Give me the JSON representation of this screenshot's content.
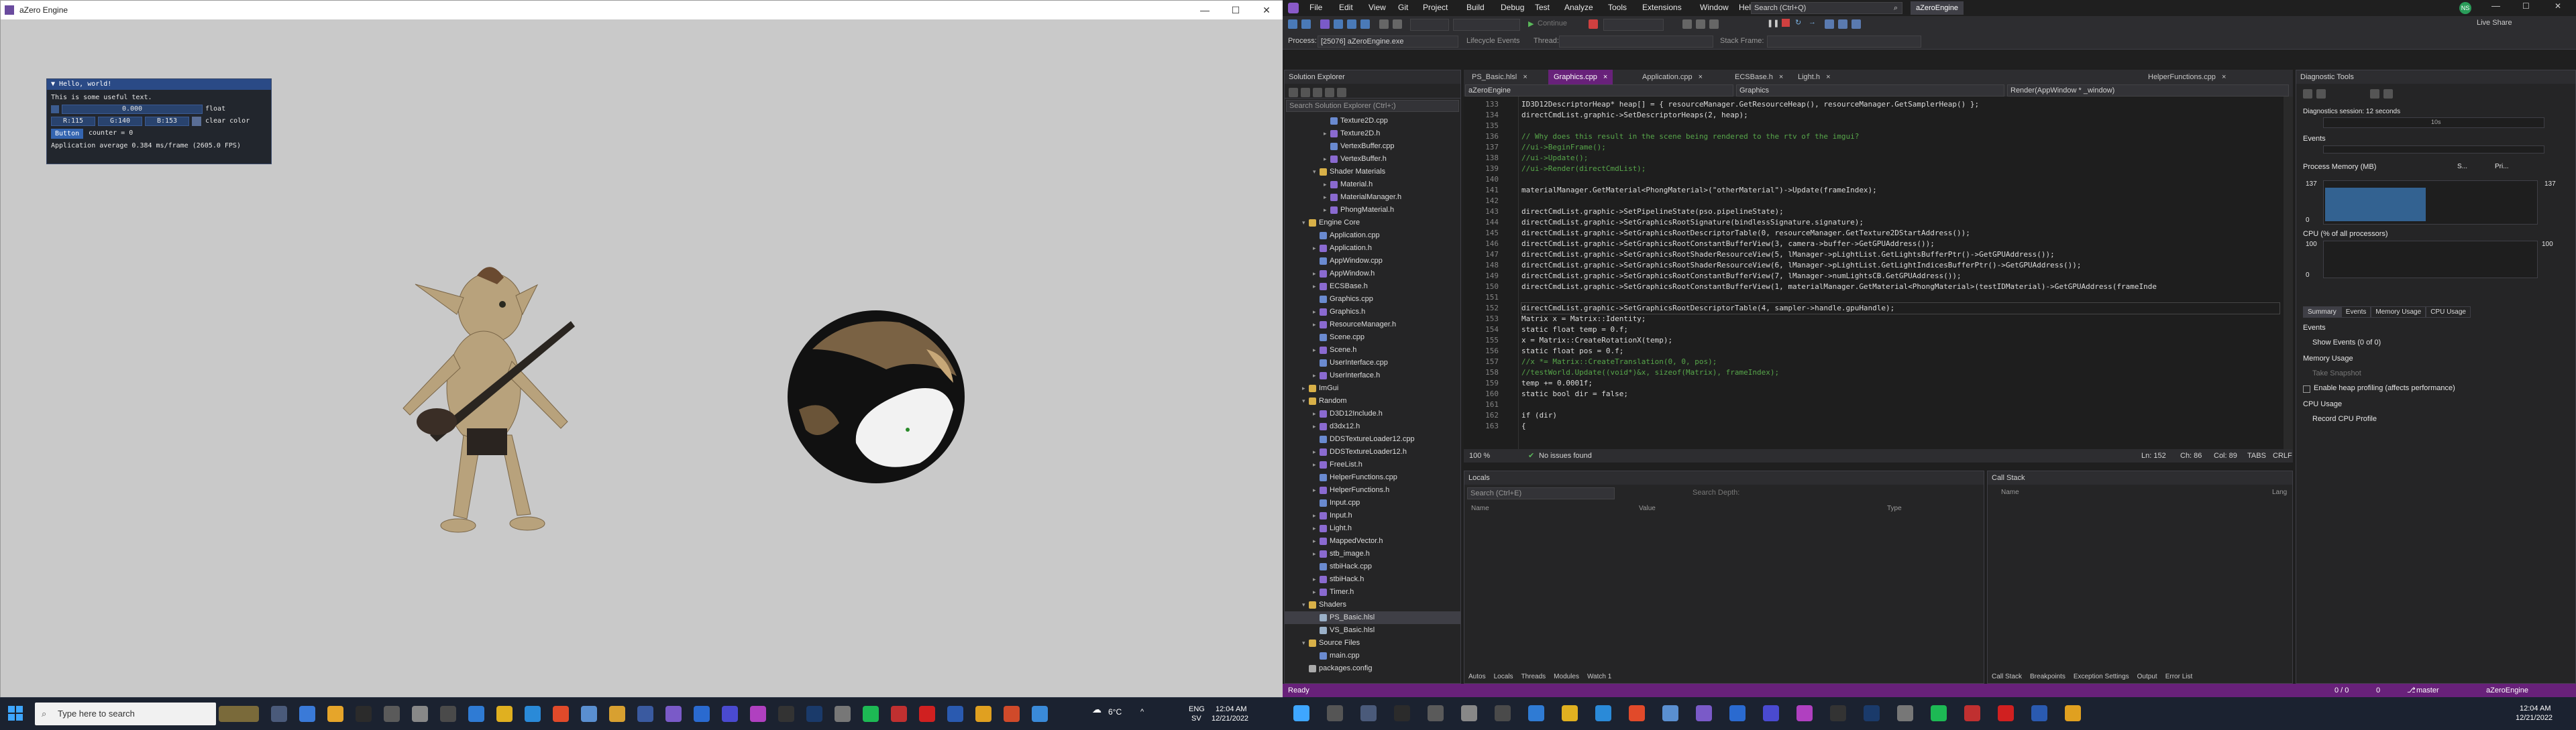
{
  "game": {
    "title": "aZero Engine",
    "imgui": {
      "window_title": "Hello, world!",
      "text": "This is some useful text.",
      "float_value": "0.000",
      "float_label": "float",
      "clear_r": "R:115",
      "clear_g": "G:140",
      "clear_b": "B:153",
      "clear_label": "clear color",
      "button": "Button",
      "counter": "counter = 0",
      "fps": "Application average 0.384 ms/frame (2605.0 FPS)"
    }
  },
  "taskbar": {
    "search_placeholder": "Type here to search",
    "weather": "6°C",
    "lang1": "ENG",
    "lang2": "SV",
    "time": "12:04 AM",
    "date": "12/21/2022"
  },
  "vs": {
    "menu": [
      "File",
      "Edit",
      "View",
      "Git",
      "Project",
      "Build",
      "Debug",
      "Test",
      "Analyze",
      "Tools",
      "Extensions",
      "Window",
      "Help"
    ],
    "search": "Search (Ctrl+Q)",
    "solution_name": "aZeroEngine",
    "avatar": "NS",
    "live_share": "Live Share",
    "continue": "Continue",
    "process_label": "Process:",
    "process_value": "[25076] aZeroEngine.exe",
    "lifecycle": "Lifecycle Events",
    "thread": "Thread:",
    "stack_frame": "Stack Frame:",
    "solution_explorer": {
      "title": "Solution Explorer",
      "search": "Search Solution Explorer (Ctrl+;)",
      "items": [
        {
          "label": "Texture2D.cpp",
          "depth": 3,
          "icon": "cpp",
          "exp": ""
        },
        {
          "label": "Texture2D.h",
          "depth": 3,
          "icon": "h",
          "exp": "▸"
        },
        {
          "label": "VertexBuffer.cpp",
          "depth": 3,
          "icon": "cpp",
          "exp": ""
        },
        {
          "label": "VertexBuffer.h",
          "depth": 3,
          "icon": "h",
          "exp": "▸"
        },
        {
          "label": "Shader Materials",
          "depth": 2,
          "icon": "folder",
          "exp": "▾"
        },
        {
          "label": "Material.h",
          "depth": 3,
          "icon": "h",
          "exp": "▸"
        },
        {
          "label": "MaterialManager.h",
          "depth": 3,
          "icon": "h",
          "exp": "▸"
        },
        {
          "label": "PhongMaterial.h",
          "depth": 3,
          "icon": "h",
          "exp": "▸"
        },
        {
          "label": "Engine Core",
          "depth": 1,
          "icon": "folder",
          "exp": "▾"
        },
        {
          "label": "Application.cpp",
          "depth": 2,
          "icon": "cpp",
          "exp": ""
        },
        {
          "label": "Application.h",
          "depth": 2,
          "icon": "h",
          "exp": "▸"
        },
        {
          "label": "AppWindow.cpp",
          "depth": 2,
          "icon": "cpp",
          "exp": ""
        },
        {
          "label": "AppWindow.h",
          "depth": 2,
          "icon": "h",
          "exp": "▸"
        },
        {
          "label": "ECSBase.h",
          "depth": 2,
          "icon": "h",
          "exp": "▸"
        },
        {
          "label": "Graphics.cpp",
          "depth": 2,
          "icon": "cpp",
          "exp": ""
        },
        {
          "label": "Graphics.h",
          "depth": 2,
          "icon": "h",
          "exp": "▸"
        },
        {
          "label": "ResourceManager.h",
          "depth": 2,
          "icon": "h",
          "exp": "▸"
        },
        {
          "label": "Scene.cpp",
          "depth": 2,
          "icon": "cpp",
          "exp": ""
        },
        {
          "label": "Scene.h",
          "depth": 2,
          "icon": "h",
          "exp": "▸"
        },
        {
          "label": "UserInterface.cpp",
          "depth": 2,
          "icon": "cpp",
          "exp": ""
        },
        {
          "label": "UserInterface.h",
          "depth": 2,
          "icon": "h",
          "exp": "▸"
        },
        {
          "label": "ImGui",
          "depth": 1,
          "icon": "folder",
          "exp": "▸"
        },
        {
          "label": "Random",
          "depth": 1,
          "icon": "folder",
          "exp": "▾"
        },
        {
          "label": "D3D12Include.h",
          "depth": 2,
          "icon": "h",
          "exp": "▸"
        },
        {
          "label": "d3dx12.h",
          "depth": 2,
          "icon": "h",
          "exp": "▸"
        },
        {
          "label": "DDSTextureLoader12.cpp",
          "depth": 2,
          "icon": "cpp",
          "exp": ""
        },
        {
          "label": "DDSTextureLoader12.h",
          "depth": 2,
          "icon": "h",
          "exp": "▸"
        },
        {
          "label": "FreeList.h",
          "depth": 2,
          "icon": "h",
          "exp": "▸"
        },
        {
          "label": "HelperFunctions.cpp",
          "depth": 2,
          "icon": "cpp",
          "exp": ""
        },
        {
          "label": "HelperFunctions.h",
          "depth": 2,
          "icon": "h",
          "exp": "▸"
        },
        {
          "label": "Input.cpp",
          "depth": 2,
          "icon": "cpp",
          "exp": ""
        },
        {
          "label": "Input.h",
          "depth": 2,
          "icon": "h",
          "exp": "▸"
        },
        {
          "label": "Light.h",
          "depth": 2,
          "icon": "h",
          "exp": "▸"
        },
        {
          "label": "MappedVector.h",
          "depth": 2,
          "icon": "h",
          "exp": "▸"
        },
        {
          "label": "stb_image.h",
          "depth": 2,
          "icon": "h",
          "exp": "▸"
        },
        {
          "label": "stbiHack.cpp",
          "depth": 2,
          "icon": "cpp",
          "exp": ""
        },
        {
          "label": "stbiHack.h",
          "depth": 2,
          "icon": "h",
          "exp": "▸"
        },
        {
          "label": "Timer.h",
          "depth": 2,
          "icon": "h",
          "exp": "▸"
        },
        {
          "label": "Shaders",
          "depth": 1,
          "icon": "folder",
          "exp": "▾"
        },
        {
          "label": "PS_Basic.hlsl",
          "depth": 2,
          "icon": "hlsl",
          "exp": ""
        },
        {
          "label": "VS_Basic.hlsl",
          "depth": 2,
          "icon": "hlsl",
          "exp": ""
        },
        {
          "label": "Source Files",
          "depth": 1,
          "icon": "folder",
          "exp": "▾"
        },
        {
          "label": "main.cpp",
          "depth": 2,
          "icon": "cpp",
          "exp": ""
        },
        {
          "label": "packages.config",
          "depth": 1,
          "icon": "cfg",
          "exp": ""
        }
      ]
    },
    "tabs": [
      "PS_Basic.hlsl",
      "Graphics.cpp",
      "Application.cpp",
      "ECSBase.h",
      "Light.h",
      "HelperFunctions.cpp"
    ],
    "nav": {
      "project": "aZeroEngine",
      "scope": "Graphics",
      "member": "Render(AppWindow * _window)"
    },
    "code": [
      {
        "n": "133",
        "t": "ID3D12DescriptorHeap* heap[] = { resourceManager.GetResourceHeap(), resourceManager.GetSamplerHeap() };"
      },
      {
        "n": "134",
        "t": "directCmdList.graphic->SetDescriptorHeaps(2, heap);"
      },
      {
        "n": "135",
        "t": ""
      },
      {
        "n": "136",
        "t": "// Why does this result in the scene being rendered to the rtv of the imgui?",
        "c": 1
      },
      {
        "n": "137",
        "t": "//ui->BeginFrame();",
        "c": 1
      },
      {
        "n": "138",
        "t": "//ui->Update();",
        "c": 1
      },
      {
        "n": "139",
        "t": "//ui->Render(directCmdList);",
        "c": 1
      },
      {
        "n": "140",
        "t": ""
      },
      {
        "n": "141",
        "t": "materialManager.GetMaterial<PhongMaterial>(\"otherMaterial\")->Update(frameIndex);"
      },
      {
        "n": "142",
        "t": ""
      },
      {
        "n": "143",
        "t": "directCmdList.graphic->SetPipelineState(pso.pipelineState);"
      },
      {
        "n": "144",
        "t": "directCmdList.graphic->SetGraphicsRootSignature(bindlessSignature.signature);"
      },
      {
        "n": "145",
        "t": "directCmdList.graphic->SetGraphicsRootDescriptorTable(0, resourceManager.GetTexture2DStartAddress());"
      },
      {
        "n": "146",
        "t": "directCmdList.graphic->SetGraphicsRootConstantBufferView(3, camera->buffer->GetGPUAddress());"
      },
      {
        "n": "147",
        "t": "directCmdList.graphic->SetGraphicsRootShaderResourceView(5, lManager->pLightList.GetLightsBufferPtr()->GetGPUAddress());"
      },
      {
        "n": "148",
        "t": "directCmdList.graphic->SetGraphicsRootShaderResourceView(6, lManager->pLightList.GetLightIndicesBufferPtr()->GetGPUAddress());"
      },
      {
        "n": "149",
        "t": "directCmdList.graphic->SetGraphicsRootConstantBufferView(7, lManager->numLightsCB.GetGPUAddress());"
      },
      {
        "n": "150",
        "t": "directCmdList.graphic->SetGraphicsRootConstantBufferView(1, materialManager.GetMaterial<PhongMaterial>(testIDMaterial)->GetGPUAddress(frameInde"
      },
      {
        "n": "151",
        "t": ""
      },
      {
        "n": "152",
        "t": "directCmdList.graphic->SetGraphicsRootDescriptorTable(4, sampler->handle.gpuHandle);"
      },
      {
        "n": "153",
        "t": "Matrix x = Matrix::Identity;"
      },
      {
        "n": "154",
        "t": "static float temp = 0.f;"
      },
      {
        "n": "155",
        "t": "x = Matrix::CreateRotationX(temp);"
      },
      {
        "n": "156",
        "t": "static float pos = 0.f;"
      },
      {
        "n": "157",
        "t": "//x *= Matrix::CreateTranslation(0, 0, pos);",
        "c": 1
      },
      {
        "n": "158",
        "t": "//testWorld.Update((void*)&x, sizeof(Matrix), frameIndex);",
        "c": 1
      },
      {
        "n": "159",
        "t": "temp += 0.0001f;"
      },
      {
        "n": "160",
        "t": "static bool dir = false;"
      },
      {
        "n": "161",
        "t": ""
      },
      {
        "n": "162",
        "t": "if (dir)"
      },
      {
        "n": "163",
        "t": "{"
      }
    ],
    "editor_status": {
      "zoom": "100 %",
      "issues": "No issues found",
      "ln": "Ln: 152",
      "ch": "Ch: 86",
      "col": "Col: 89",
      "tabs": "TABS",
      "eol": "CRLF"
    },
    "locals": {
      "title": "Locals",
      "search": "Search (Ctrl+E)",
      "depth": "Search Depth:",
      "col_name": "Name",
      "col_value": "Value",
      "col_type": "Type",
      "tabs": [
        "Autos",
        "Locals",
        "Threads",
        "Modules",
        "Watch 1"
      ]
    },
    "callstack": {
      "title": "Call Stack",
      "col_name": "Name",
      "col_lang": "Lang",
      "tabs": [
        "Call Stack",
        "Breakpoints",
        "Exception Settings",
        "Output",
        "Error List"
      ]
    },
    "diag": {
      "title": "Diagnostic Tools",
      "session": "Diagnostics session: 12 seconds",
      "time_tick": "10s",
      "events": "Events",
      "process_memory": "Process Memory (MB)",
      "mem_snapshot": "S...",
      "mem_private": "Pri...",
      "mem_val": "137",
      "mem_min": "0",
      "cpu": "CPU (% of all processors)",
      "cpu_max": "100",
      "cpu_min": "0",
      "tabs": [
        "Summary",
        "Events",
        "Memory Usage",
        "CPU Usage"
      ],
      "events_h": "Events",
      "show_events": "Show Events (0 of 0)",
      "memory_usage": "Memory Usage",
      "take_snapshot": "Take Snapshot",
      "heap_profiling": "Enable heap profiling (affects performance)",
      "cpu_usage": "CPU Usage",
      "record_cpu": "Record CPU Profile"
    },
    "status": {
      "ready": "Ready",
      "changes": "0 / 0",
      "pencil": "0",
      "branch": "master",
      "repo": "aZeroEngine"
    },
    "task_time": "12:04 AM",
    "task_date": "12/21/2022"
  },
  "colors": {
    "accent": "#68217a",
    "taskbar": "#1b2230",
    "imgui_title": "#2a4a86"
  }
}
